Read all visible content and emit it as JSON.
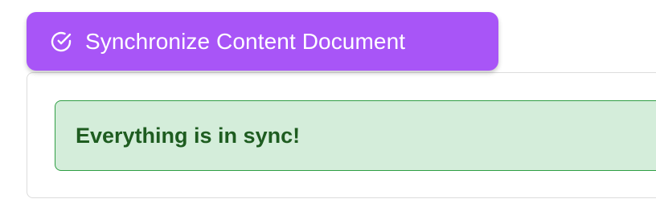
{
  "sync_button": {
    "label": "Synchronize Content Document",
    "icon": "check-circle-icon",
    "color": "#a855f7"
  },
  "status_alert": {
    "message": "Everything is in sync!",
    "background_color": "#d4edda",
    "border_color": "#2f9e44",
    "text_color": "#1e5c20"
  }
}
